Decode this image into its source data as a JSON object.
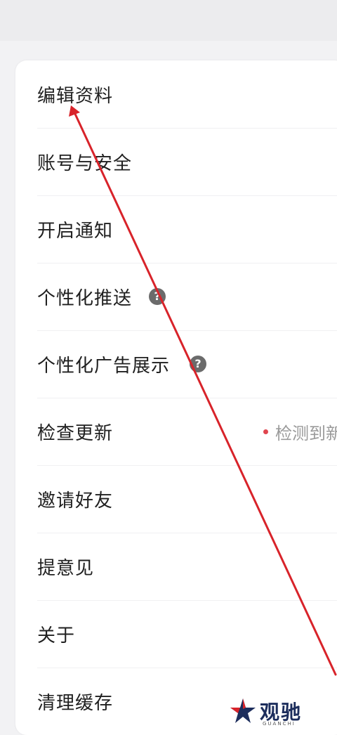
{
  "settings": {
    "items": [
      {
        "label": "编辑资料"
      },
      {
        "label": "账号与安全"
      },
      {
        "label": "开启通知"
      },
      {
        "label": "个性化推送"
      },
      {
        "label": "个性化广告展示"
      },
      {
        "label": "检查更新",
        "status": "检测到新"
      },
      {
        "label": "邀请好友"
      },
      {
        "label": "提意见"
      },
      {
        "label": "关于"
      },
      {
        "label": "清理缓存"
      }
    ],
    "help_glyph": "?"
  },
  "watermark": {
    "name": "观驰",
    "sub": "GUANCHI"
  },
  "colors": {
    "arrow": "#d8232a",
    "status_dot": "#e0454f"
  }
}
